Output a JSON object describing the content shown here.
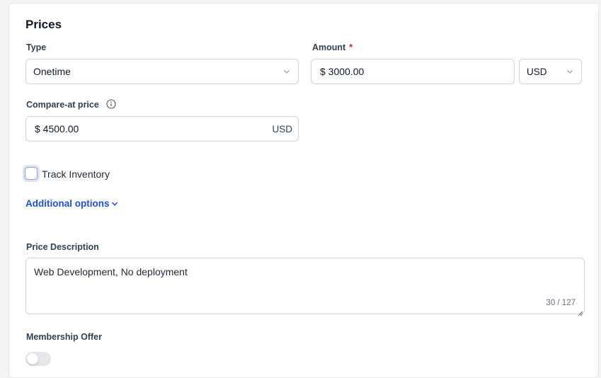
{
  "prices": {
    "title": "Prices",
    "type": {
      "label": "Type",
      "value": "Onetime"
    },
    "amount": {
      "label": "Amount",
      "required_mark": "*",
      "value": "$ 3000.00",
      "currency": "USD"
    },
    "compare_at": {
      "label": "Compare-at price",
      "value": "$ 4500.00",
      "suffix": "USD"
    },
    "track_inventory": {
      "label": "Track Inventory",
      "checked": false
    },
    "additional_options": {
      "label": "Additional options"
    },
    "description": {
      "label": "Price Description",
      "value": "Web Development, No deployment",
      "counter": "30 / 127"
    },
    "membership": {
      "label": "Membership Offer",
      "enabled": false
    }
  },
  "colors": {
    "accent": "#1d4ed8",
    "required": "#dc2626",
    "border": "#d0d5dd"
  }
}
